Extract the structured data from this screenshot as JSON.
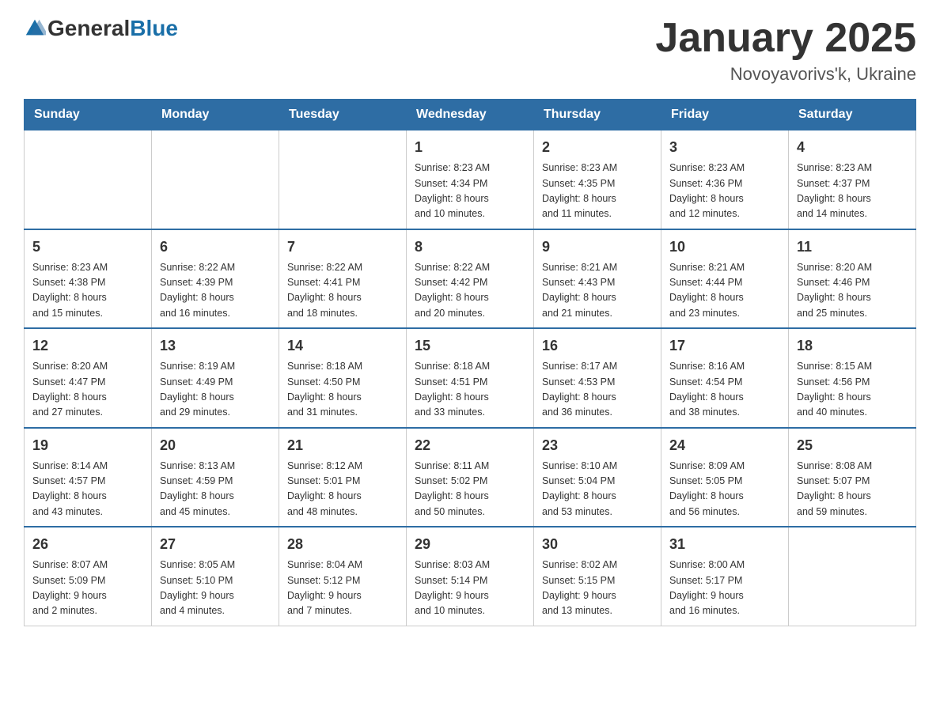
{
  "header": {
    "logo": {
      "text_general": "General",
      "text_blue": "Blue",
      "arrow_icon": "▶"
    },
    "title": "January 2025",
    "location": "Novoyavorivs'k, Ukraine"
  },
  "calendar": {
    "days_of_week": [
      "Sunday",
      "Monday",
      "Tuesday",
      "Wednesday",
      "Thursday",
      "Friday",
      "Saturday"
    ],
    "weeks": [
      [
        {
          "day": "",
          "info": ""
        },
        {
          "day": "",
          "info": ""
        },
        {
          "day": "",
          "info": ""
        },
        {
          "day": "1",
          "info": "Sunrise: 8:23 AM\nSunset: 4:34 PM\nDaylight: 8 hours\nand 10 minutes."
        },
        {
          "day": "2",
          "info": "Sunrise: 8:23 AM\nSunset: 4:35 PM\nDaylight: 8 hours\nand 11 minutes."
        },
        {
          "day": "3",
          "info": "Sunrise: 8:23 AM\nSunset: 4:36 PM\nDaylight: 8 hours\nand 12 minutes."
        },
        {
          "day": "4",
          "info": "Sunrise: 8:23 AM\nSunset: 4:37 PM\nDaylight: 8 hours\nand 14 minutes."
        }
      ],
      [
        {
          "day": "5",
          "info": "Sunrise: 8:23 AM\nSunset: 4:38 PM\nDaylight: 8 hours\nand 15 minutes."
        },
        {
          "day": "6",
          "info": "Sunrise: 8:22 AM\nSunset: 4:39 PM\nDaylight: 8 hours\nand 16 minutes."
        },
        {
          "day": "7",
          "info": "Sunrise: 8:22 AM\nSunset: 4:41 PM\nDaylight: 8 hours\nand 18 minutes."
        },
        {
          "day": "8",
          "info": "Sunrise: 8:22 AM\nSunset: 4:42 PM\nDaylight: 8 hours\nand 20 minutes."
        },
        {
          "day": "9",
          "info": "Sunrise: 8:21 AM\nSunset: 4:43 PM\nDaylight: 8 hours\nand 21 minutes."
        },
        {
          "day": "10",
          "info": "Sunrise: 8:21 AM\nSunset: 4:44 PM\nDaylight: 8 hours\nand 23 minutes."
        },
        {
          "day": "11",
          "info": "Sunrise: 8:20 AM\nSunset: 4:46 PM\nDaylight: 8 hours\nand 25 minutes."
        }
      ],
      [
        {
          "day": "12",
          "info": "Sunrise: 8:20 AM\nSunset: 4:47 PM\nDaylight: 8 hours\nand 27 minutes."
        },
        {
          "day": "13",
          "info": "Sunrise: 8:19 AM\nSunset: 4:49 PM\nDaylight: 8 hours\nand 29 minutes."
        },
        {
          "day": "14",
          "info": "Sunrise: 8:18 AM\nSunset: 4:50 PM\nDaylight: 8 hours\nand 31 minutes."
        },
        {
          "day": "15",
          "info": "Sunrise: 8:18 AM\nSunset: 4:51 PM\nDaylight: 8 hours\nand 33 minutes."
        },
        {
          "day": "16",
          "info": "Sunrise: 8:17 AM\nSunset: 4:53 PM\nDaylight: 8 hours\nand 36 minutes."
        },
        {
          "day": "17",
          "info": "Sunrise: 8:16 AM\nSunset: 4:54 PM\nDaylight: 8 hours\nand 38 minutes."
        },
        {
          "day": "18",
          "info": "Sunrise: 8:15 AM\nSunset: 4:56 PM\nDaylight: 8 hours\nand 40 minutes."
        }
      ],
      [
        {
          "day": "19",
          "info": "Sunrise: 8:14 AM\nSunset: 4:57 PM\nDaylight: 8 hours\nand 43 minutes."
        },
        {
          "day": "20",
          "info": "Sunrise: 8:13 AM\nSunset: 4:59 PM\nDaylight: 8 hours\nand 45 minutes."
        },
        {
          "day": "21",
          "info": "Sunrise: 8:12 AM\nSunset: 5:01 PM\nDaylight: 8 hours\nand 48 minutes."
        },
        {
          "day": "22",
          "info": "Sunrise: 8:11 AM\nSunset: 5:02 PM\nDaylight: 8 hours\nand 50 minutes."
        },
        {
          "day": "23",
          "info": "Sunrise: 8:10 AM\nSunset: 5:04 PM\nDaylight: 8 hours\nand 53 minutes."
        },
        {
          "day": "24",
          "info": "Sunrise: 8:09 AM\nSunset: 5:05 PM\nDaylight: 8 hours\nand 56 minutes."
        },
        {
          "day": "25",
          "info": "Sunrise: 8:08 AM\nSunset: 5:07 PM\nDaylight: 8 hours\nand 59 minutes."
        }
      ],
      [
        {
          "day": "26",
          "info": "Sunrise: 8:07 AM\nSunset: 5:09 PM\nDaylight: 9 hours\nand 2 minutes."
        },
        {
          "day": "27",
          "info": "Sunrise: 8:05 AM\nSunset: 5:10 PM\nDaylight: 9 hours\nand 4 minutes."
        },
        {
          "day": "28",
          "info": "Sunrise: 8:04 AM\nSunset: 5:12 PM\nDaylight: 9 hours\nand 7 minutes."
        },
        {
          "day": "29",
          "info": "Sunrise: 8:03 AM\nSunset: 5:14 PM\nDaylight: 9 hours\nand 10 minutes."
        },
        {
          "day": "30",
          "info": "Sunrise: 8:02 AM\nSunset: 5:15 PM\nDaylight: 9 hours\nand 13 minutes."
        },
        {
          "day": "31",
          "info": "Sunrise: 8:00 AM\nSunset: 5:17 PM\nDaylight: 9 hours\nand 16 minutes."
        },
        {
          "day": "",
          "info": ""
        }
      ]
    ]
  }
}
